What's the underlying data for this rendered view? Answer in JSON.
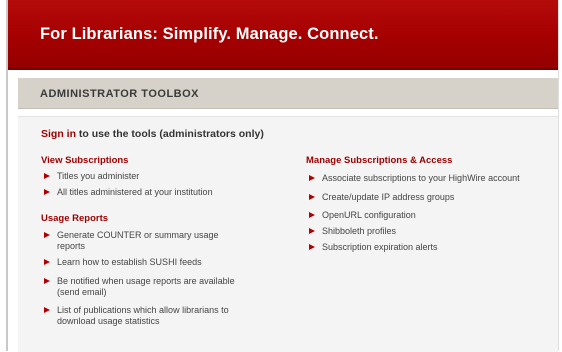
{
  "banner": {
    "title": "For Librarians: Simplify. Manage. Connect."
  },
  "toolbox": {
    "title": "ADMINISTRATOR TOOLBOX"
  },
  "signin": {
    "link": "Sign in",
    "text": " to use the tools (administrators only)"
  },
  "left": {
    "view_subscriptions": {
      "title": "View Subscriptions",
      "items": [
        "Titles you administer",
        "All titles administered at your institution"
      ]
    },
    "usage_reports": {
      "title": "Usage Reports",
      "items": [
        "Generate COUNTER or summary usage reports",
        "Learn how to establish SUSHI feeds",
        "Be notified when usage reports are available (send email)",
        "List of publications which allow librarians to download usage statistics"
      ]
    }
  },
  "right": {
    "manage": {
      "title": "Manage Subscriptions & Access",
      "items": [
        "Associate subscriptions to your HighWire account",
        "Create/update IP address groups",
        "OpenURL configuration",
        "Shibboleth profiles",
        "Subscription expiration alerts"
      ]
    }
  },
  "colors": {
    "banner": "#a50000",
    "accent": "#9b0000",
    "toolbar": "#d6d2ca"
  },
  "icons": {
    "bullet": "right-triangle-arrow"
  }
}
